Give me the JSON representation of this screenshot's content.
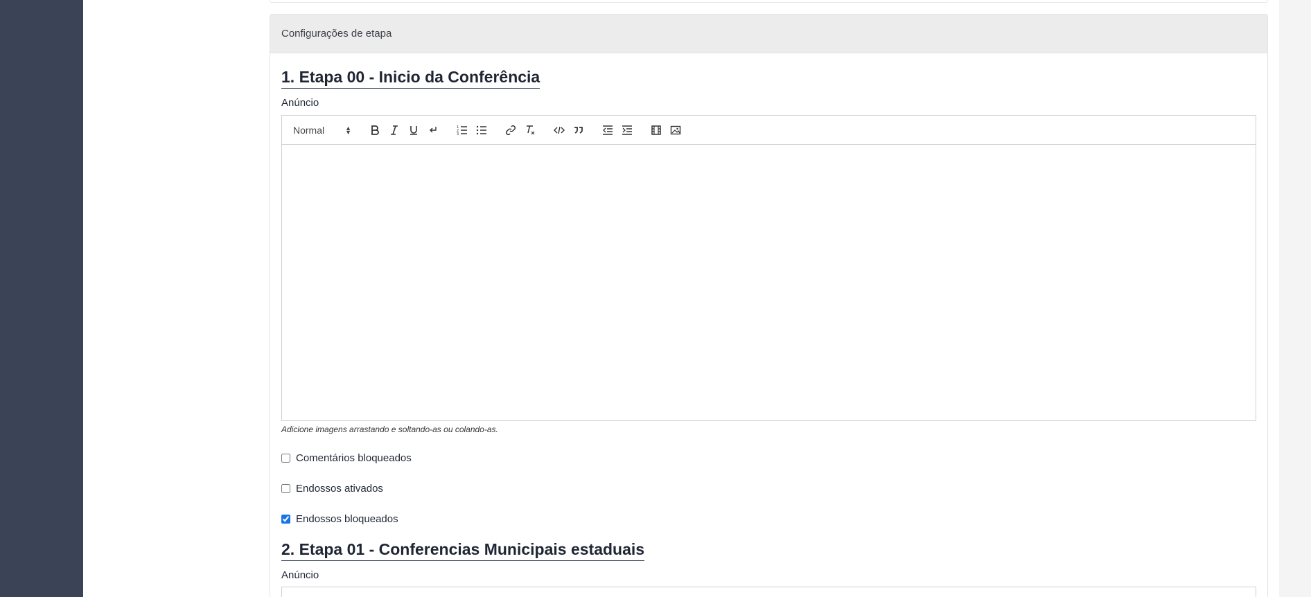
{
  "section": {
    "header": "Configurações de etapa"
  },
  "steps": [
    {
      "title": "1. Etapa 00 - Inicio da Conferência",
      "announcement_label": "Anúncio",
      "editor": {
        "header_select": "Normal",
        "content": "",
        "helper": "Adicione imagens arrastando e soltando-as ou colando-as."
      },
      "options": [
        {
          "label": "Comentários bloqueados",
          "checked": false
        },
        {
          "label": "Endossos ativados",
          "checked": false
        },
        {
          "label": "Endossos bloqueados",
          "checked": true
        }
      ]
    },
    {
      "title": "2. Etapa 01 - Conferencias Municipais estaduais",
      "announcement_label": "Anúncio"
    }
  ],
  "toolbar_icons": [
    "bold-icon",
    "italic-icon",
    "underline-icon",
    "link-break-icon",
    "ordered-list-icon",
    "bullet-list-icon",
    "link-icon",
    "clear-format-icon",
    "code-icon",
    "blockquote-icon",
    "outdent-icon",
    "indent-icon",
    "video-icon",
    "image-icon"
  ],
  "colors": {
    "leftbar": "#3a4456",
    "title": "#1f2532",
    "checkbox_accent": "#1a73e8"
  }
}
